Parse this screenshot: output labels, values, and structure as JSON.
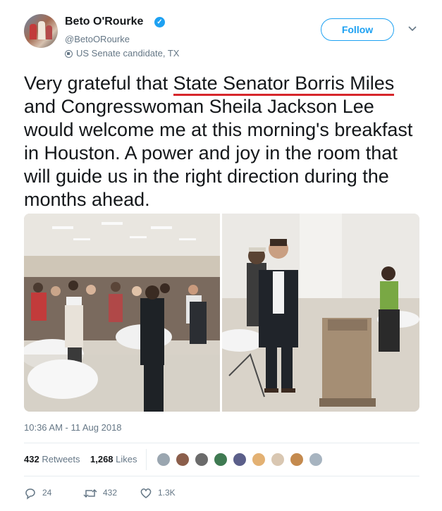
{
  "author": {
    "name": "Beto O'Rourke",
    "handle": "@BetoORourke",
    "label": "US Senate candidate, TX"
  },
  "follow_label": "Follow",
  "tweet": {
    "text_before": "Very grateful that ",
    "underlined": "State Senator Borris Miles",
    "text_after": " and Congresswoman Sheila Jackson Lee would welcome me at this morning's breakfast in Houston. A power and joy in the room that will guide us in the right direction during the months ahead."
  },
  "timestamp": "10:36 AM - 11 Aug 2018",
  "stats": {
    "retweets_count": "432",
    "retweets_label": "Retweets",
    "likes_count": "1,268",
    "likes_label": "Likes"
  },
  "actions": {
    "replies": "24",
    "retweets": "432",
    "likes": "1.3K"
  },
  "icons": {
    "verified": "verified-badge-icon",
    "label": "government-label-icon",
    "caret": "chevron-down-icon",
    "reply": "reply-icon",
    "retweet": "retweet-icon",
    "like": "heart-icon"
  },
  "colors": {
    "accent": "#1da1f2",
    "underline": "#d6262b",
    "muted": "#657786"
  }
}
